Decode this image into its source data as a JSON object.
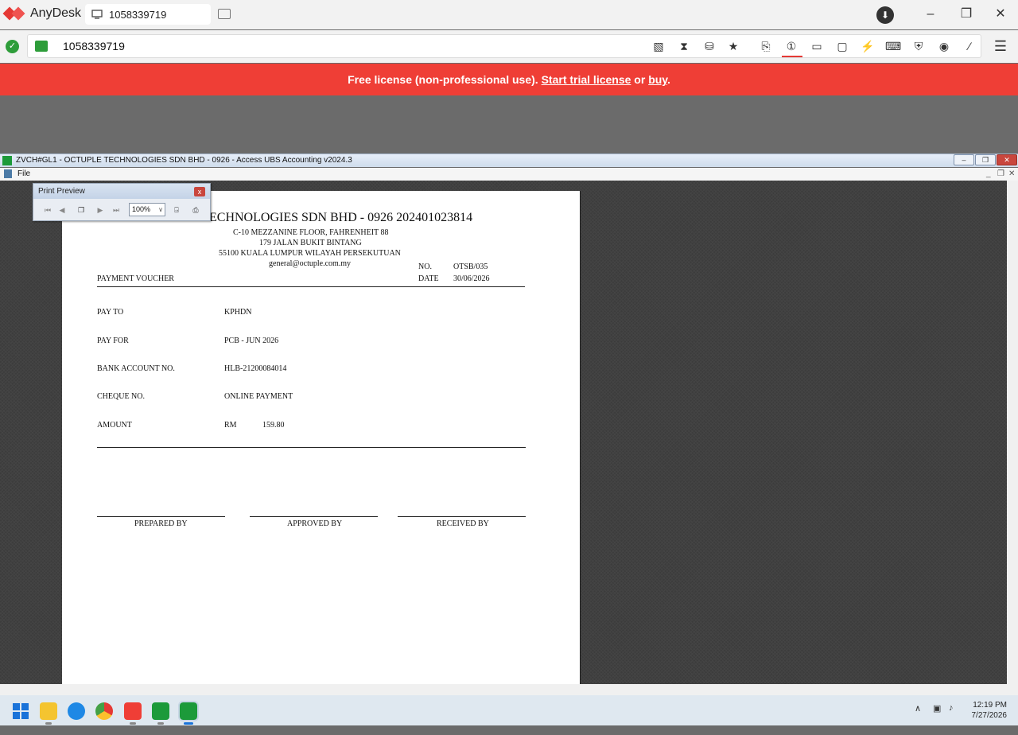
{
  "anydesk": {
    "app_name": "AnyDesk",
    "tab_label": "1058339719",
    "address": "1058339719",
    "license_text": "Free license (non-professional use).",
    "trial_link": "Start trial license",
    "or_text": "or",
    "buy_link": "buy",
    "period": "."
  },
  "remote_window": {
    "title": "ZVCH#GL1 - OCTUPLE TECHNOLOGIES SDN BHD - 0926 - Access UBS Accounting v2024.3",
    "menu_file": "File"
  },
  "print_preview": {
    "title": "Print Preview",
    "zoom": "100%"
  },
  "voucher": {
    "company": "ECHNOLOGIES SDN BHD - 0926 202401023814",
    "address1": "C-10 MEZZANINE FLOOR, FAHRENHEIT 88",
    "address2": "179 JALAN BUKIT BINTANG",
    "address3": "55100 KUALA LUMPUR WILAYAH PERSEKUTUAN",
    "email": "general@octuple.com.my",
    "no_label": "NO.",
    "no_value": "OTSB/035",
    "date_label": "DATE",
    "date_value": "30/06/2026",
    "doc_title": "PAYMENT VOUCHER",
    "pay_to_label": "PAY TO",
    "pay_to_value": "KPHDN",
    "pay_for_label": "PAY FOR",
    "pay_for_value": "PCB - JUN 2026",
    "bank_label": "BANK ACCOUNT NO.",
    "bank_value": "HLB-21200084014",
    "cheque_label": "CHEQUE NO.",
    "cheque_value": "ONLINE PAYMENT",
    "amount_label": "AMOUNT",
    "currency": "RM",
    "amount_value": "159.80",
    "prepared_by": "PREPARED BY",
    "approved_by": "APPROVED BY",
    "received_by": "RECEIVED BY"
  },
  "taskbar": {
    "time": "12:19 PM",
    "date": "7/27/2026"
  },
  "colors": {
    "anydesk_red": "#ef3e36",
    "connected_green": "#2e9d3a"
  }
}
